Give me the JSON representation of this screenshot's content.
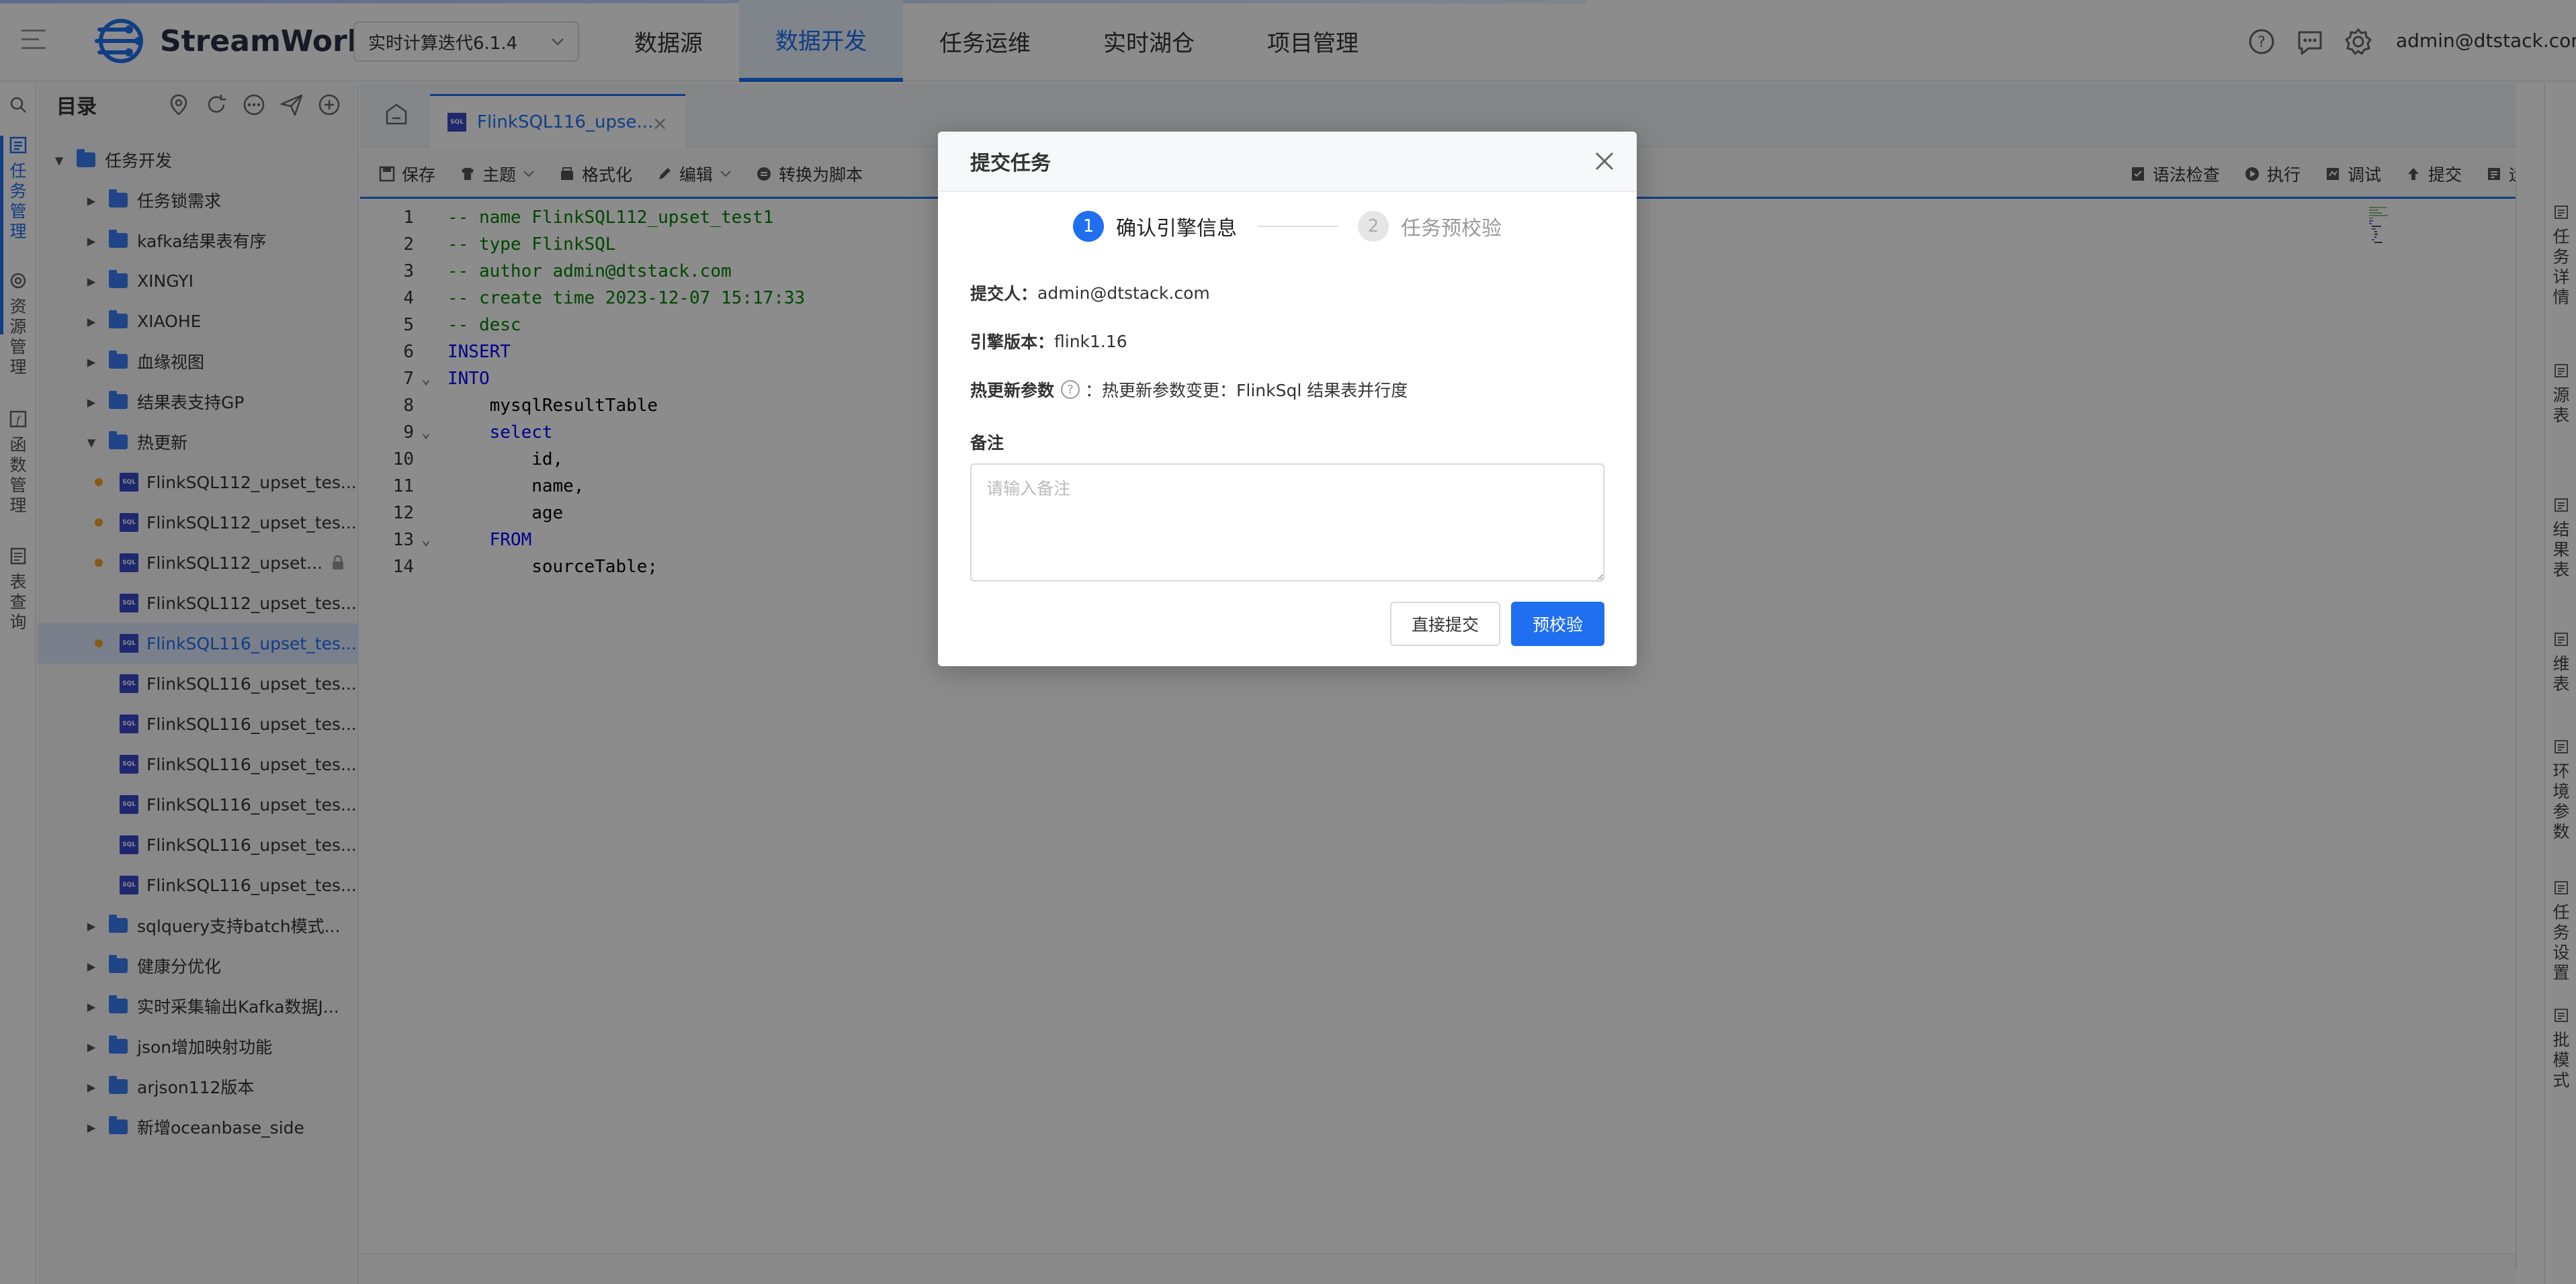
{
  "app": {
    "name": "StreamWorks",
    "version_select": "实时计算迭代6.1.4"
  },
  "nav": {
    "items": [
      "数据源",
      "数据开发",
      "任务运维",
      "实时湖仓",
      "项目管理"
    ],
    "active": "数据开发"
  },
  "header": {
    "user": "admin@dtstack.com"
  },
  "leftbar": {
    "items": [
      {
        "label": "任务管理",
        "icon": "task-icon",
        "active": true
      },
      {
        "label": "资源管理",
        "icon": "resource-icon"
      },
      {
        "label": "函数管理",
        "icon": "function-icon"
      },
      {
        "label": "表查询",
        "icon": "table-icon"
      }
    ]
  },
  "sidebar": {
    "title": "目录",
    "root": "任务开发",
    "folders_before": [
      "任务锁需求",
      "kafka结果表有序",
      "XINGYI",
      "XIAOHE",
      "血缘视图",
      "结果表支持GP"
    ],
    "open_folder": "热更新",
    "files": [
      {
        "label": "FlinkSQL112_upset_tes...",
        "dot": true
      },
      {
        "label": "FlinkSQL112_upset_tes...",
        "dot": true
      },
      {
        "label": "FlinkSQL112_upset...",
        "dot": true,
        "lock": true
      },
      {
        "label": "FlinkSQL112_upset_tes...",
        "dot": false
      },
      {
        "label": "FlinkSQL116_upset_tes...",
        "dot": true,
        "selected": true
      },
      {
        "label": "FlinkSQL116_upset_tes...",
        "dot": false
      },
      {
        "label": "FlinkSQL116_upset_tes...",
        "dot": false
      },
      {
        "label": "FlinkSQL116_upset_tes...",
        "dot": false
      },
      {
        "label": "FlinkSQL116_upset_tes...",
        "dot": false
      },
      {
        "label": "FlinkSQL116_upset_tes...",
        "dot": false
      },
      {
        "label": "FlinkSQL116_upset_tes...",
        "dot": false
      }
    ],
    "folders_after": [
      "sqlquery支持batch模式...",
      "健康分优化",
      "实时采集输出Kafka数据J...",
      "json增加映射功能",
      "arjson112版本",
      "新增oceanbase_side"
    ]
  },
  "editor": {
    "tab_label": "FlinkSQL116_upse...",
    "file_icon_text": "SQL",
    "toolbar_left": [
      {
        "label": "保存",
        "icon": "save-icon"
      },
      {
        "label": "主题",
        "icon": "theme-icon",
        "dropdown": true
      },
      {
        "label": "格式化",
        "icon": "format-icon"
      },
      {
        "label": "编辑",
        "icon": "edit-icon",
        "dropdown": true
      },
      {
        "label": "转换为脚本",
        "icon": "convert-icon"
      }
    ],
    "toolbar_right": [
      {
        "label": "语法检查",
        "icon": "syntax-check-icon"
      },
      {
        "label": "执行",
        "icon": "run-icon"
      },
      {
        "label": "调试",
        "icon": "debug-icon"
      },
      {
        "label": "提交",
        "icon": "submit-icon"
      },
      {
        "label": "运维",
        "icon": "ops-icon"
      }
    ],
    "lines": [
      {
        "n": "1",
        "text": "-- name FlinkSQL112_upset_test1",
        "cls": "comment"
      },
      {
        "n": "2",
        "text": "-- type FlinkSQL",
        "cls": "comment"
      },
      {
        "n": "3",
        "text": "-- author admin@dtstack.com",
        "cls": "comment"
      },
      {
        "n": "4",
        "text": "-- create time 2023-12-07 15:17:33",
        "cls": "comment"
      },
      {
        "n": "5",
        "text": "-- desc",
        "cls": "comment"
      },
      {
        "n": "6",
        "text": "INSERT",
        "cls": "kw"
      },
      {
        "n": "7",
        "text": "INTO",
        "cls": "kw",
        "fold": true
      },
      {
        "n": "8",
        "text": "    mysqlResultTable",
        "cls": "plain"
      },
      {
        "n": "9",
        "text": "    select",
        "cls": "kw",
        "fold": true
      },
      {
        "n": "10",
        "text": "        id,",
        "cls": "plain"
      },
      {
        "n": "11",
        "text": "        name,",
        "cls": "plain"
      },
      {
        "n": "12",
        "text": "        age",
        "cls": "plain"
      },
      {
        "n": "13",
        "text": "    FROM",
        "cls": "kw",
        "fold": true
      },
      {
        "n": "14",
        "text": "        sourceTable;",
        "cls": "plain"
      }
    ]
  },
  "rightpanel": {
    "items": [
      "任务详情",
      "源表",
      "结果表",
      "维表",
      "环境参数",
      "任务设置",
      "批模式"
    ]
  },
  "modal": {
    "title": "提交任务",
    "steps": [
      {
        "num": "1",
        "label": "确认引擎信息"
      },
      {
        "num": "2",
        "label": "任务预校验"
      }
    ],
    "submitter_key": "提交人：",
    "submitter_val": "admin@dtstack.com",
    "engine_key": "引擎版本：",
    "engine_val": "flink1.16",
    "hot_key": "热更新参数",
    "hot_val": "：热更新参数变更：FlinkSql 结果表并行度",
    "note_label": "备注",
    "note_placeholder": "请输入备注",
    "note_value": "",
    "btn_direct": "直接提交",
    "btn_precheck": "预校验"
  }
}
